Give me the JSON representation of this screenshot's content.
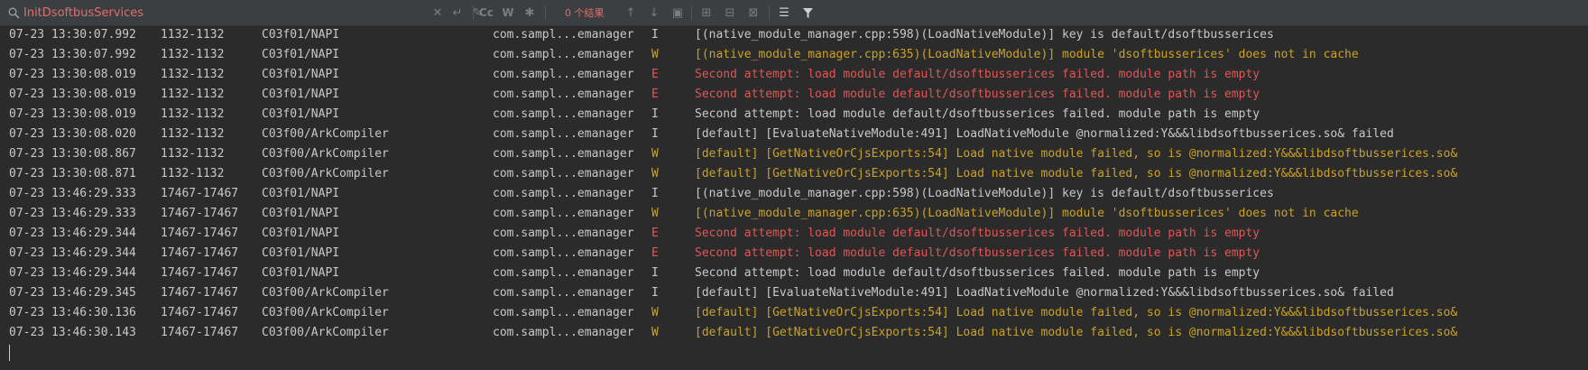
{
  "search": {
    "value": "InitDsoftbusServices"
  },
  "toolbar": {
    "case_label": "Cc",
    "word_label": "W",
    "results_label": "0 个结果"
  },
  "colors": {
    "warn": "#c9a227",
    "error": "#e05555",
    "info": "#c8c8c8",
    "search_text": "#e06c6c"
  },
  "log": [
    {
      "time": "07-23 13:30:07.992",
      "pid": "1132-1132",
      "tag": "C03f01/NAPI",
      "pkg": "com.sampl...emanager",
      "level": "I",
      "msg": "[(native_module_manager.cpp:598)(LoadNativeModule)] key is default/dsoftbusserices"
    },
    {
      "time": "07-23 13:30:07.992",
      "pid": "1132-1132",
      "tag": "C03f01/NAPI",
      "pkg": "com.sampl...emanager",
      "level": "W",
      "msg": "[(native_module_manager.cpp:635)(LoadNativeModule)] module 'dsoftbusserices' does not in cache"
    },
    {
      "time": "07-23 13:30:08.019",
      "pid": "1132-1132",
      "tag": "C03f01/NAPI",
      "pkg": "com.sampl...emanager",
      "level": "E",
      "msg": "Second attempt: load module default/dsoftbusserices failed. module path is empty"
    },
    {
      "time": "07-23 13:30:08.019",
      "pid": "1132-1132",
      "tag": "C03f01/NAPI",
      "pkg": "com.sampl...emanager",
      "level": "E",
      "msg": "Second attempt: load module default/dsoftbusserices failed. module path is empty"
    },
    {
      "time": "07-23 13:30:08.019",
      "pid": "1132-1132",
      "tag": "C03f01/NAPI",
      "pkg": "com.sampl...emanager",
      "level": "I",
      "msg": "Second attempt: load module default/dsoftbusserices failed. module path is empty"
    },
    {
      "time": "07-23 13:30:08.020",
      "pid": "1132-1132",
      "tag": "C03f00/ArkCompiler",
      "pkg": "com.sampl...emanager",
      "level": "I",
      "msg": "[default] [EvaluateNativeModule:491] LoadNativeModule @normalized:Y&&&libdsoftbusserices.so& failed"
    },
    {
      "time": "07-23 13:30:08.867",
      "pid": "1132-1132",
      "tag": "C03f00/ArkCompiler",
      "pkg": "com.sampl...emanager",
      "level": "W",
      "msg": "[default] [GetNativeOrCjsExports:54] Load native module failed, so is @normalized:Y&&&libdsoftbusserices.so&"
    },
    {
      "time": "07-23 13:30:08.871",
      "pid": "1132-1132",
      "tag": "C03f00/ArkCompiler",
      "pkg": "com.sampl...emanager",
      "level": "W",
      "msg": "[default] [GetNativeOrCjsExports:54] Load native module failed, so is @normalized:Y&&&libdsoftbusserices.so&"
    },
    {
      "time": "07-23 13:46:29.333",
      "pid": "17467-17467",
      "tag": "C03f01/NAPI",
      "pkg": "com.sampl...emanager",
      "level": "I",
      "msg": "[(native_module_manager.cpp:598)(LoadNativeModule)] key is default/dsoftbusserices"
    },
    {
      "time": "07-23 13:46:29.333",
      "pid": "17467-17467",
      "tag": "C03f01/NAPI",
      "pkg": "com.sampl...emanager",
      "level": "W",
      "msg": "[(native_module_manager.cpp:635)(LoadNativeModule)] module 'dsoftbusserices' does not in cache"
    },
    {
      "time": "07-23 13:46:29.344",
      "pid": "17467-17467",
      "tag": "C03f01/NAPI",
      "pkg": "com.sampl...emanager",
      "level": "E",
      "msg": "Second attempt: load module default/dsoftbusserices failed. module path is empty"
    },
    {
      "time": "07-23 13:46:29.344",
      "pid": "17467-17467",
      "tag": "C03f01/NAPI",
      "pkg": "com.sampl...emanager",
      "level": "E",
      "msg": "Second attempt: load module default/dsoftbusserices failed. module path is empty"
    },
    {
      "time": "07-23 13:46:29.344",
      "pid": "17467-17467",
      "tag": "C03f01/NAPI",
      "pkg": "com.sampl...emanager",
      "level": "I",
      "msg": "Second attempt: load module default/dsoftbusserices failed. module path is empty"
    },
    {
      "time": "07-23 13:46:29.345",
      "pid": "17467-17467",
      "tag": "C03f00/ArkCompiler",
      "pkg": "com.sampl...emanager",
      "level": "I",
      "msg": "[default] [EvaluateNativeModule:491] LoadNativeModule @normalized:Y&&&libdsoftbusserices.so& failed"
    },
    {
      "time": "07-23 13:46:30.136",
      "pid": "17467-17467",
      "tag": "C03f00/ArkCompiler",
      "pkg": "com.sampl...emanager",
      "level": "W",
      "msg": "[default] [GetNativeOrCjsExports:54] Load native module failed, so is @normalized:Y&&&libdsoftbusserices.so&"
    },
    {
      "time": "07-23 13:46:30.143",
      "pid": "17467-17467",
      "tag": "C03f00/ArkCompiler",
      "pkg": "com.sampl...emanager",
      "level": "W",
      "msg": "[default] [GetNativeOrCjsExports:54] Load native module failed, so is @normalized:Y&&&libdsoftbusserices.so&"
    }
  ]
}
